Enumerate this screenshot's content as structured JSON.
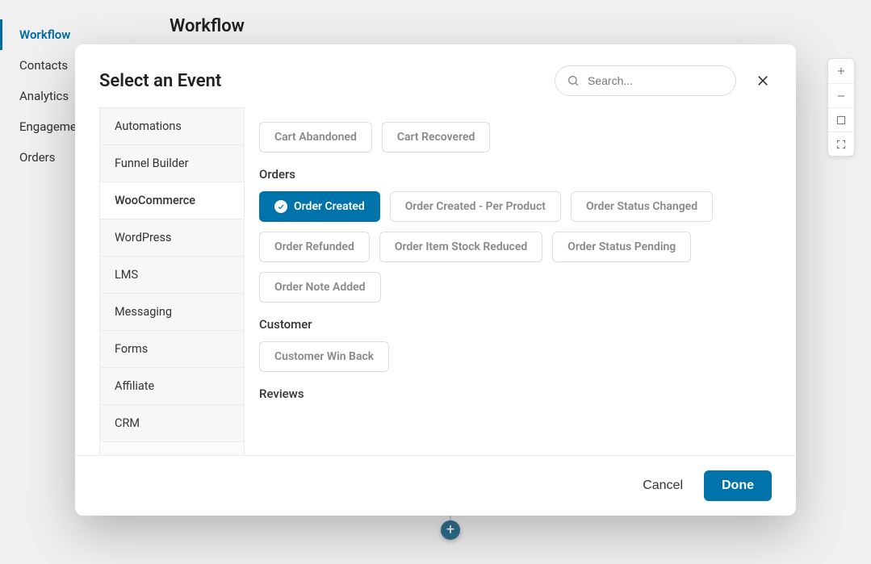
{
  "bgNav": {
    "items": [
      {
        "label": "Workflow",
        "active": true
      },
      {
        "label": "Contacts"
      },
      {
        "label": "Analytics"
      },
      {
        "label": "Engageme"
      },
      {
        "label": "Orders"
      }
    ],
    "pageTitle": "Workflow"
  },
  "modal": {
    "title": "Select an Event",
    "searchPlaceholder": "Search...",
    "categories": [
      {
        "label": "Automations"
      },
      {
        "label": "Funnel Builder"
      },
      {
        "label": "WooCommerce",
        "active": true
      },
      {
        "label": "WordPress"
      },
      {
        "label": "LMS"
      },
      {
        "label": "Messaging"
      },
      {
        "label": "Forms"
      },
      {
        "label": "Affiliate"
      },
      {
        "label": "CRM"
      }
    ],
    "sections": [
      {
        "title": "",
        "events": [
          {
            "label": "Cart Abandoned"
          },
          {
            "label": "Cart Recovered"
          }
        ]
      },
      {
        "title": "Orders",
        "events": [
          {
            "label": "Order Created",
            "selected": true
          },
          {
            "label": "Order Created - Per Product"
          },
          {
            "label": "Order Status Changed"
          },
          {
            "label": "Order Refunded"
          },
          {
            "label": "Order Item Stock Reduced"
          },
          {
            "label": "Order Status Pending"
          },
          {
            "label": "Order Note Added"
          }
        ]
      },
      {
        "title": "Customer",
        "events": [
          {
            "label": "Customer Win Back"
          }
        ]
      },
      {
        "title": "Reviews",
        "events": []
      }
    ],
    "footer": {
      "cancel": "Cancel",
      "done": "Done"
    }
  },
  "addNode": "+"
}
